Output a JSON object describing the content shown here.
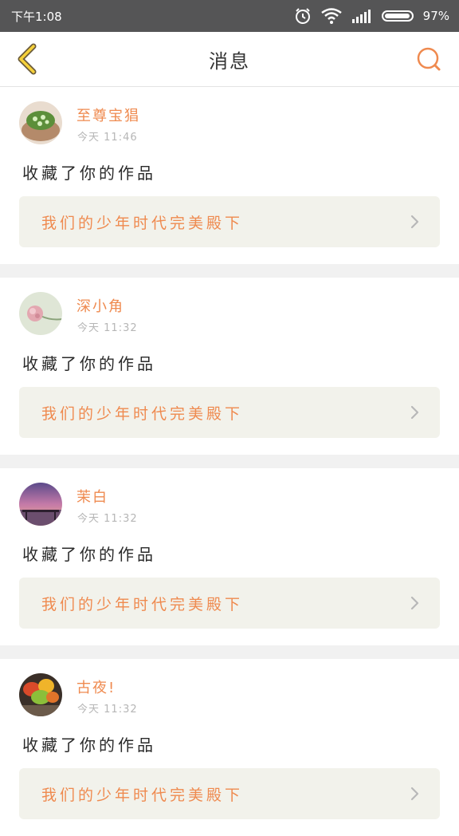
{
  "status_bar": {
    "time": "下午1:08",
    "battery": "97%",
    "battery_level": 0.97,
    "icons": [
      "alarm-icon",
      "wifi-icon",
      "signal-icon",
      "battery-icon"
    ]
  },
  "header": {
    "title": "消息",
    "icons": [
      "chevron-left-icon",
      "search-icon"
    ],
    "accent_color": "#f0a030",
    "search_color": "#ef8a4f"
  },
  "notifications": [
    {
      "username": "至尊宝猖",
      "date": "今天",
      "time": "11:46",
      "action": "收藏了你的作品",
      "work_title": "我们的少年时代完美殿下",
      "avatar": "avatar-icon-plant"
    },
    {
      "username": "深小角",
      "date": "今天",
      "time": "11:32",
      "action": "收藏了你的作品",
      "work_title": "我们的少年时代完美殿下",
      "avatar": "avatar-icon-flower"
    },
    {
      "username": "茉白",
      "date": "今天",
      "time": "11:32",
      "action": "收藏了你的作品",
      "work_title": "我们的少年时代完美殿下",
      "avatar": "avatar-icon-sunset"
    },
    {
      "username": "古夜!",
      "date": "今天",
      "time": "11:32",
      "action": "收藏了你的作品",
      "work_title": "我们的少年时代完美殿下",
      "avatar": "avatar-icon-leaves"
    }
  ],
  "colors": {
    "name": "#ef8a4f",
    "link_bg": "#f2f2eb",
    "separator": "#f1f1f1"
  }
}
